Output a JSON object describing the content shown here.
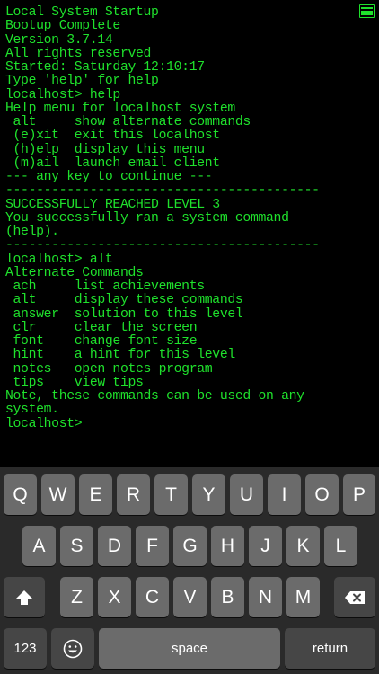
{
  "terminal": {
    "lines": [
      "Local System Startup",
      "Bootup Complete",
      "Version 3.7.14",
      "All rights reserved",
      "Started: Saturday 12:10:17",
      "Type 'help' for help",
      "localhost> help",
      "Help menu for localhost system",
      " alt     show alternate commands",
      " (e)xit  exit this localhost",
      " (h)elp  display this menu",
      " (m)ail  launch email client",
      "--- any key to continue ---",
      "-----------------------------------------",
      "SUCCESSFULLY REACHED LEVEL 3",
      "You successfully ran a system command",
      "(help).",
      "-----------------------------------------",
      "localhost> alt",
      "Alternate Commands",
      " ach     list achievements",
      " alt     display these commands",
      " answer  solution to this level",
      " clr     clear the screen",
      " font    change font size",
      " hint    a hint for this level",
      " notes   open notes program",
      " tips    view tips",
      "Note, these commands can be used on any",
      "system.",
      "localhost>"
    ],
    "text_color": "#1fe12c",
    "background": "#000000"
  },
  "header": {
    "menu_icon": "hamburger-menu-icon"
  },
  "keyboard": {
    "row1": [
      "Q",
      "W",
      "E",
      "R",
      "T",
      "Y",
      "U",
      "I",
      "O",
      "P"
    ],
    "row2": [
      "A",
      "S",
      "D",
      "F",
      "G",
      "H",
      "J",
      "K",
      "L"
    ],
    "row3": [
      "Z",
      "X",
      "C",
      "V",
      "B",
      "N",
      "M"
    ],
    "shift_icon": "shift-arrow-icon",
    "delete_icon": "backspace-icon",
    "numbers_label": "123",
    "emoji_icon": "emoji-icon",
    "space_label": "space",
    "return_label": "return"
  }
}
